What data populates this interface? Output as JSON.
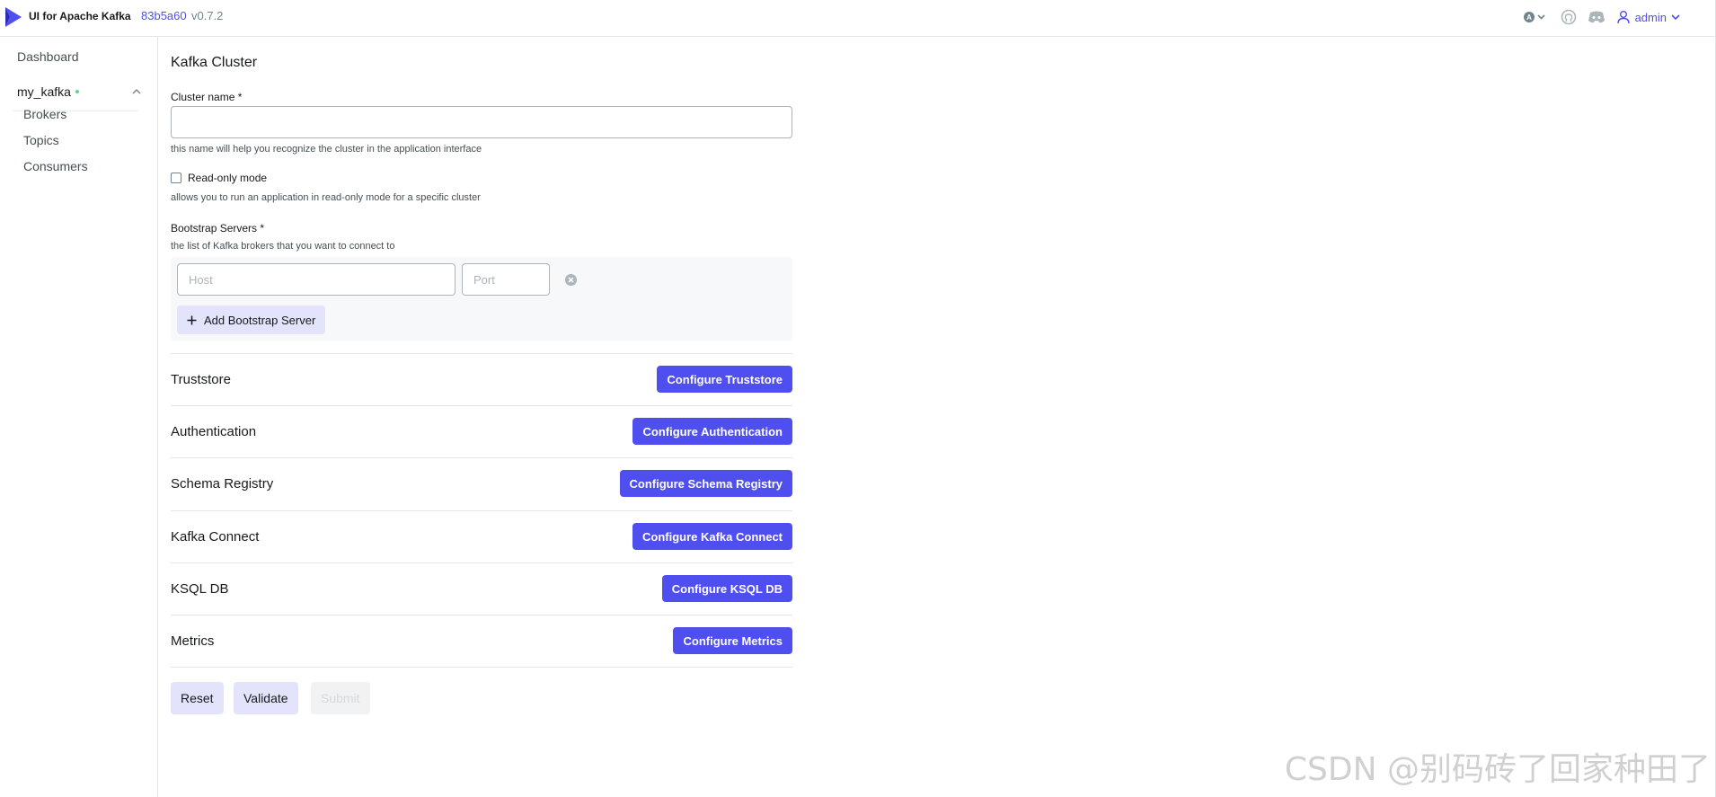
{
  "header": {
    "app_title": "UI for Apache Kafka",
    "commit": "83b5a60",
    "version": "v0.7.2",
    "user": "admin",
    "icons": [
      "logo-icon",
      "theme-icon",
      "chevron-down-icon",
      "github-icon",
      "discord-icon",
      "user-icon"
    ],
    "accent_color": "#4f4ff0"
  },
  "sidebar": {
    "dashboard": "Dashboard",
    "cluster": {
      "name": "my_kafka",
      "status": "online",
      "status_color": "#5cd685",
      "items": [
        {
          "label": "Brokers"
        },
        {
          "label": "Topics"
        },
        {
          "label": "Consumers"
        }
      ]
    }
  },
  "form": {
    "title": "Kafka Cluster",
    "cluster_name": {
      "label": "Cluster name *",
      "value": "",
      "hint": "this name will help you recognize the cluster in the application interface"
    },
    "read_only": {
      "label": "Read-only mode",
      "checked": false,
      "hint": "allows you to run an application in read-only mode for a specific cluster"
    },
    "bootstrap": {
      "label": "Bootstrap Servers *",
      "hint": "the list of Kafka brokers that you want to connect to",
      "host_placeholder": "Host",
      "port_placeholder": "Port",
      "add_label": "Add Bootstrap Server"
    },
    "sections": [
      {
        "label": "Truststore",
        "button": "Configure Truststore"
      },
      {
        "label": "Authentication",
        "button": "Configure Authentication"
      },
      {
        "label": "Schema Registry",
        "button": "Configure Schema Registry"
      },
      {
        "label": "Kafka Connect",
        "button": "Configure Kafka Connect"
      },
      {
        "label": "KSQL DB",
        "button": "Configure KSQL DB"
      },
      {
        "label": "Metrics",
        "button": "Configure Metrics"
      }
    ],
    "actions": {
      "reset": "Reset",
      "validate": "Validate",
      "submit": "Submit"
    }
  },
  "watermark": "CSDN @别码砖了回家种田了"
}
